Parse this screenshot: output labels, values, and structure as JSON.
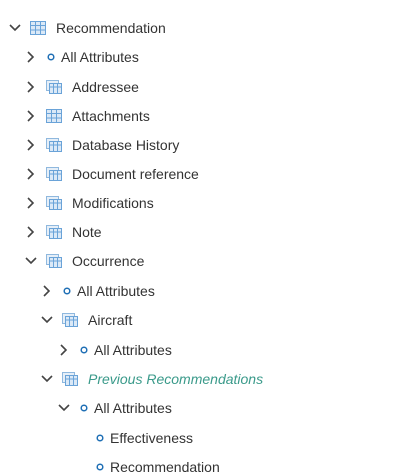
{
  "tree": {
    "root": {
      "label": "Recommendation",
      "icon": "table-icon",
      "expanded": true
    },
    "r1": {
      "label": "All Attributes",
      "icon": "attribute-dot-icon",
      "expanded": false
    },
    "r2": {
      "label": "Addressee",
      "icon": "linked-table-icon",
      "expanded": false
    },
    "r3": {
      "label": "Attachments",
      "icon": "table-icon",
      "expanded": false
    },
    "r4": {
      "label": "Database History",
      "icon": "linked-table-icon",
      "expanded": false
    },
    "r5": {
      "label": "Document reference",
      "icon": "linked-table-icon",
      "expanded": false
    },
    "r6": {
      "label": "Modifications",
      "icon": "linked-table-icon",
      "expanded": false
    },
    "r7": {
      "label": "Note",
      "icon": "linked-table-icon",
      "expanded": false
    },
    "r8": {
      "label": "Occurrence",
      "icon": "linked-table-icon",
      "expanded": true
    },
    "r9": {
      "label": "All Attributes",
      "icon": "attribute-dot-icon",
      "expanded": false
    },
    "r10": {
      "label": "Aircraft",
      "icon": "linked-table-icon",
      "expanded": true
    },
    "r11": {
      "label": "All Attributes",
      "icon": "attribute-dot-icon",
      "expanded": false
    },
    "r12": {
      "label": "Previous Recommendations",
      "icon": "linked-table-icon",
      "expanded": true,
      "style": "italic",
      "color": "#3a9a8a"
    },
    "r13": {
      "label": "All Attributes",
      "icon": "attribute-dot-icon",
      "expanded": true
    },
    "r14": {
      "label": "Effectiveness",
      "icon": "attribute-dot-icon"
    },
    "r15": {
      "label": "Recommendation",
      "icon": "attribute-dot-icon"
    }
  },
  "colors": {
    "text": "#333333",
    "chevron": "#444444",
    "dot": "#1f6fb5",
    "table_icon": "#6aa3d8",
    "linked_table_icon": "#8fb8de",
    "italic_label": "#3a9a8a"
  }
}
